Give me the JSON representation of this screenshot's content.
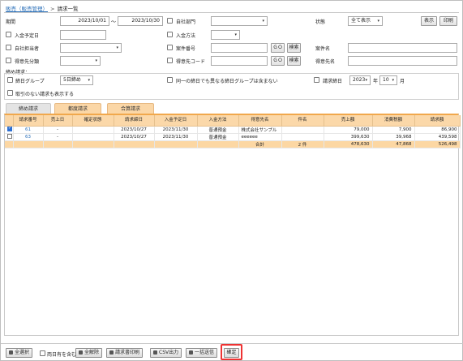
{
  "breadcrumb": {
    "link": "販売（販売管理）",
    "sep": ">",
    "current": "請求一覧"
  },
  "filters": {
    "period_label": "期間",
    "date_from": "2023/10/01",
    "tilde": "～",
    "date_to": "2023/10/30",
    "own_dept_label": "自社部門",
    "status_label": "状態",
    "status_value": "全て表示",
    "show_button": "表示",
    "print_button": "印刷",
    "payment_due_label": "入金予定日",
    "payment_method_label": "入金方法",
    "own_staff_label": "自社担当者",
    "project_no_label": "案件番号",
    "go_label": "ＧＯ",
    "search_label": "検索",
    "project_name_label": "案件名",
    "customer_category_label": "得意先分類",
    "customer_code_label": "得意先コード",
    "customer_name_label": "得意先名"
  },
  "closing": {
    "section_label": "締め請求：",
    "closing_group_label": "締日グループ",
    "closing_group_value": "5日締め",
    "same_group_label": "同一の締日でも異なる締日グループは含まない",
    "billing_date_label": "請求締日",
    "year_value": "2023",
    "year_unit": "年",
    "month_value": "10",
    "month_unit": "月",
    "no_transaction_label": "取引のない請求も表示する"
  },
  "tabs": [
    {
      "label": "締め請求"
    },
    {
      "label": "都度請求"
    },
    {
      "label": "合算請求"
    }
  ],
  "table": {
    "headers": [
      "",
      "請求番号",
      "売上日",
      "確定状態",
      "請求締日",
      "入金予定日",
      "入金方法",
      "得意先名",
      "件名",
      "売上額",
      "消費税額",
      "請求額"
    ],
    "rows": [
      {
        "checked": true,
        "no": "61",
        "sales_date": "-",
        "confirm": "",
        "closing": "2023/10/27",
        "due": "2023/11/30",
        "method": "普通預金",
        "customer": "株式会社サンプル",
        "subject": "",
        "sales": "79,000",
        "tax": "7,900",
        "billing": "86,900"
      },
      {
        "checked": false,
        "no": "63",
        "sales_date": "-",
        "confirm": "",
        "closing": "2023/10/27",
        "due": "2023/11/30",
        "method": "普通預金",
        "customer": "eeeeee",
        "subject": "",
        "sales": "399,630",
        "tax": "39,968",
        "billing": "439,598"
      }
    ],
    "total": {
      "label": "合計",
      "count": "2 件",
      "sales": "478,630",
      "tax": "47,868",
      "billing": "526,498"
    }
  },
  "bottom": {
    "select_all": "全選択",
    "include_other": "両日有を含む",
    "deselect_all": "全解除",
    "print_invoice": "請求書印刷",
    "csv_output": "CSV出力",
    "bulk_send": "一括送信",
    "confirm": "確定"
  },
  "colors": {
    "accent_orange": "#fbd8a9",
    "link_blue": "#2a6fb8",
    "highlight_red": "#e33333"
  }
}
